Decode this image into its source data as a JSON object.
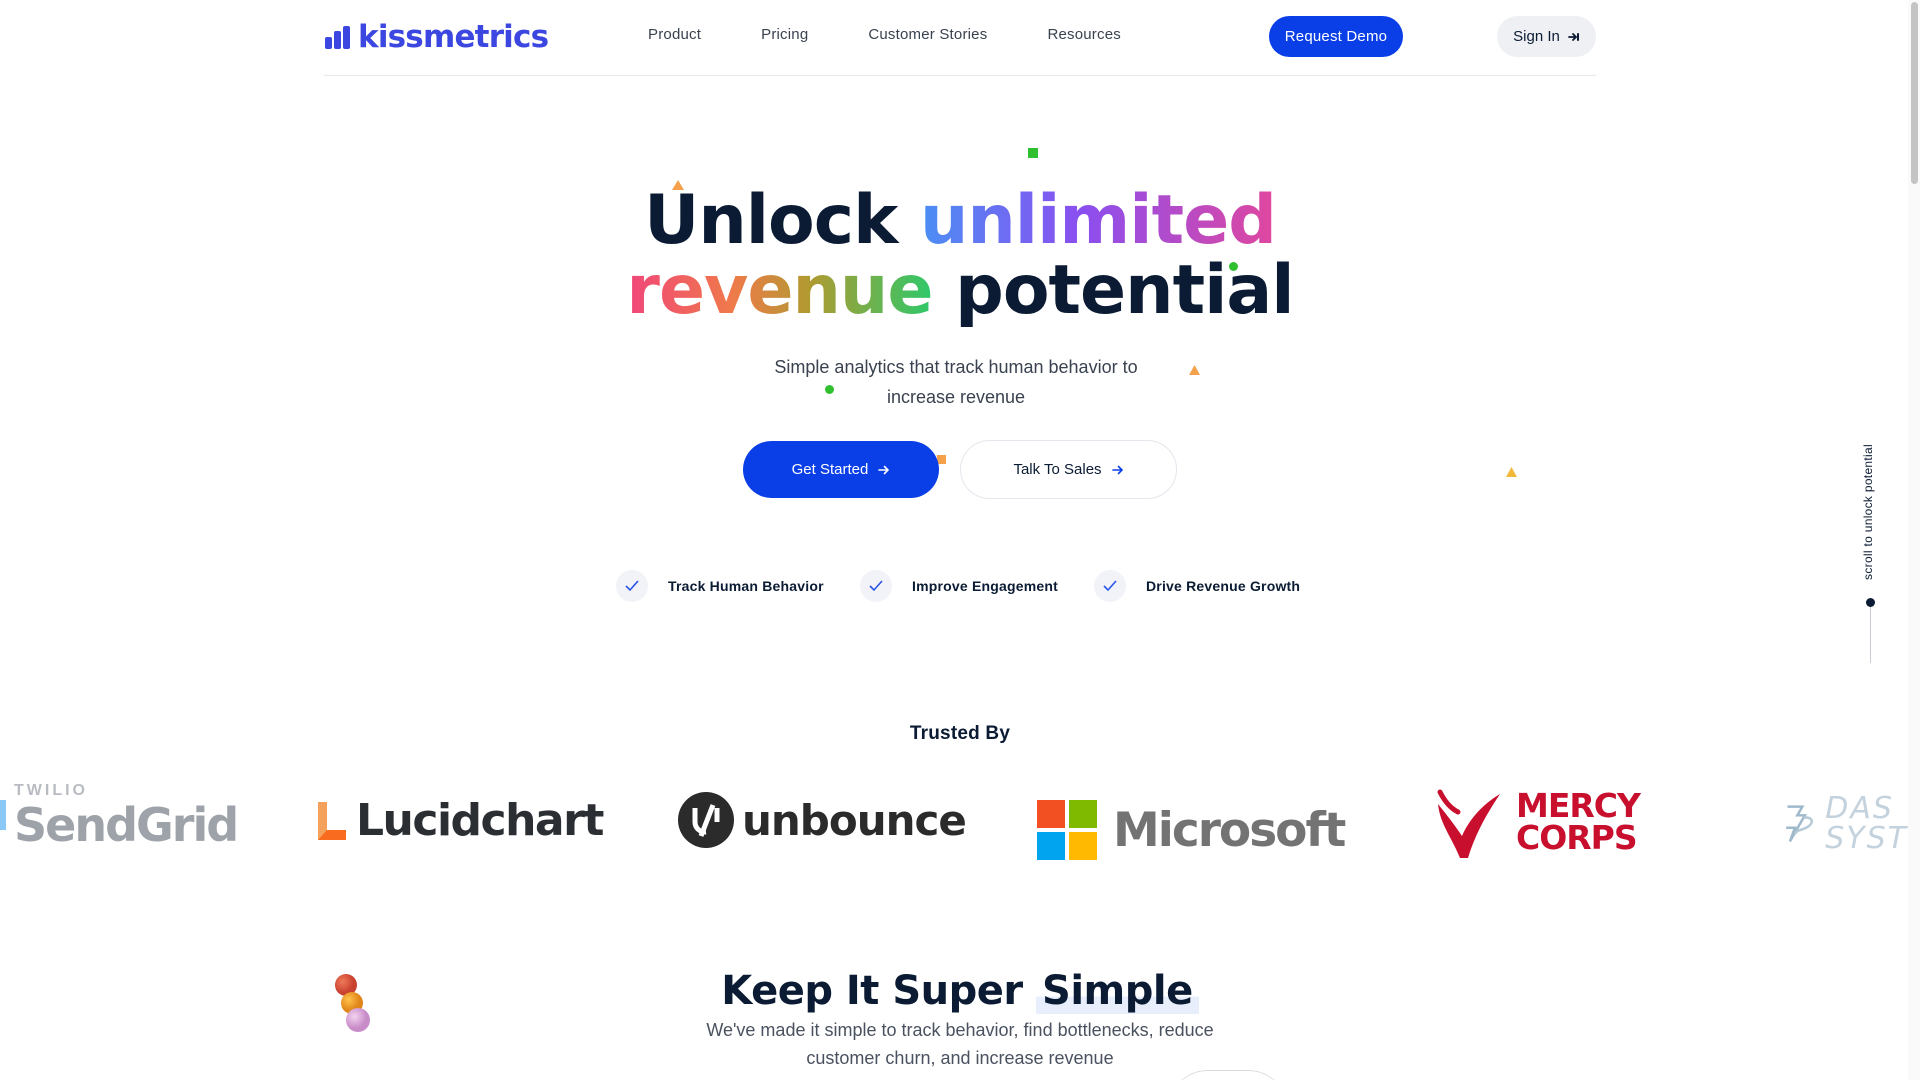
{
  "nav": {
    "logo_text": "kissmetrics",
    "links": [
      "Product",
      "Pricing",
      "Customer Stories",
      "Resources"
    ],
    "request_demo": "Request Demo",
    "sign_in": "Sign In"
  },
  "hero": {
    "title_line1_a": "Unlock",
    "title_line1_b": "unlimited",
    "title_line2_a": "revenue",
    "title_line2_b": "potential",
    "subtitle": "Simple analytics that track human behavior to increase revenue",
    "get_started": "Get Started",
    "talk_to_sales": "Talk To Sales",
    "features": [
      "Track Human Behavior",
      "Improve Engagement",
      "Drive Revenue Growth"
    ]
  },
  "side": {
    "scroll_text": "scroll to unlock potential"
  },
  "trusted": {
    "heading": "Trusted By",
    "logos": {
      "sendgrid_top": "TWILIO",
      "sendgrid": "SendGrid",
      "lucidchart": "Lucidchart",
      "unbounce": "unbounce",
      "microsoft": "Microsoft",
      "mercy_line1": "MERCY",
      "mercy_line2": "CORPS",
      "dassault_line1": "DAS",
      "dassault_line2": "SYST"
    }
  },
  "simple": {
    "title_a": "Keep It Super",
    "title_b": "Simple",
    "subtitle": "We've made it simple to track behavior, find bottlenecks, reduce customer churn, and increase revenue"
  },
  "colors": {
    "brand_blue": "#0a3ee6",
    "logo_blue": "#3b47e0",
    "navy": "#0b1b33"
  }
}
